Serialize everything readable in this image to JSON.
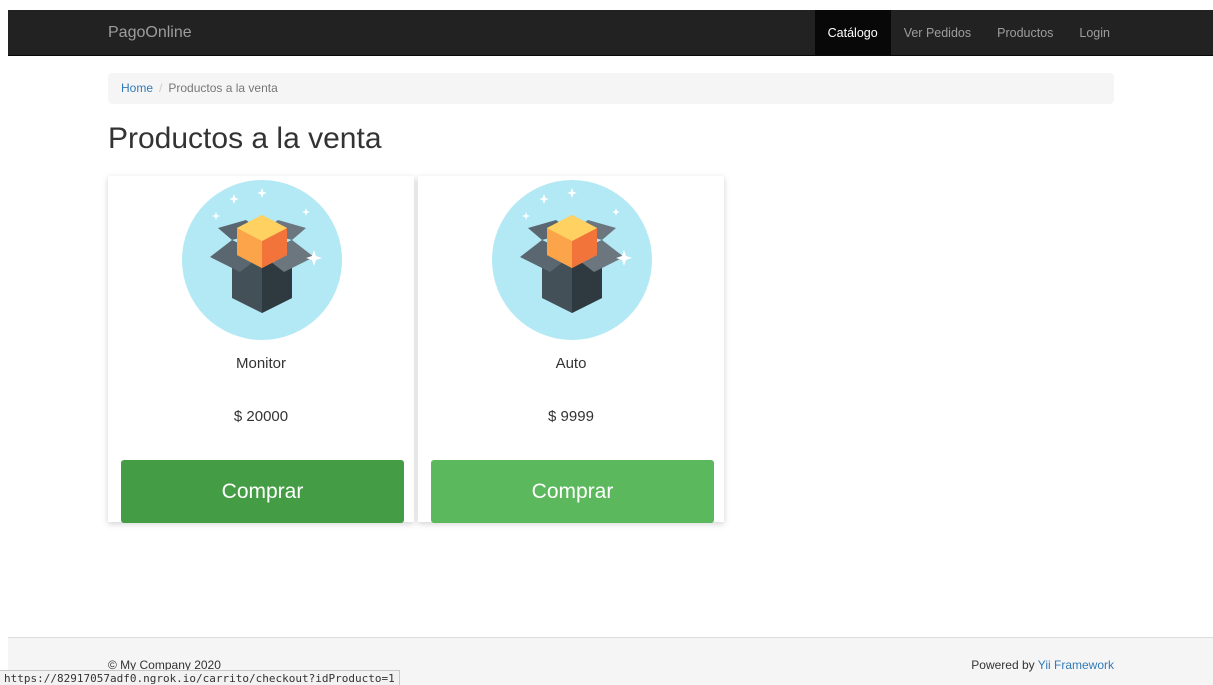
{
  "navbar": {
    "brand": "PagoOnline",
    "items": [
      {
        "label": "Catálogo",
        "active": true
      },
      {
        "label": "Ver Pedidos",
        "active": false
      },
      {
        "label": "Productos",
        "active": false
      },
      {
        "label": "Login",
        "active": false
      }
    ]
  },
  "breadcrumb": {
    "home": "Home",
    "separator": "/",
    "current": "Productos a la venta"
  },
  "page_title": "Productos a la venta",
  "products": [
    {
      "name": "Monitor",
      "price": "$ 20000",
      "button": "Comprar",
      "button_color": "#449d44",
      "image_icon": "open-box-icon"
    },
    {
      "name": "Auto",
      "price": "$ 9999",
      "button": "Comprar",
      "button_color": "#5cb85c",
      "image_icon": "open-box-icon"
    }
  ],
  "footer": {
    "copyright": "© My Company 2020",
    "powered_by": "Powered by",
    "framework": "Yii Framework"
  },
  "status_bar": {
    "url": "https://82917057adf0.ngrok.io/carrito/checkout?idProducto=1"
  },
  "colors": {
    "navbar_bg": "#222222",
    "link": "#337ab7",
    "button_hover": "#449d44",
    "button": "#5cb85c",
    "icon_circle": "#b3e9f5"
  }
}
